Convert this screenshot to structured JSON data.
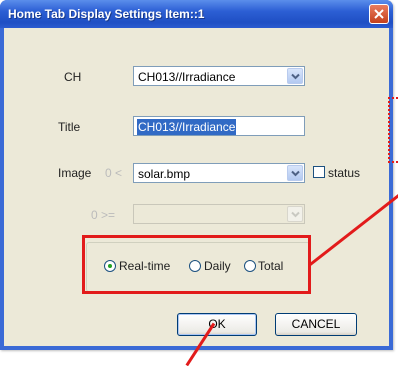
{
  "window": {
    "title": "Home Tab Display Settings Item::1"
  },
  "form": {
    "ch": {
      "label": "CH",
      "value": "CH013//Irradiance"
    },
    "title": {
      "label": "Title",
      "value": "CH013//Irradiance"
    },
    "image": {
      "label": "Image",
      "prefix": "0 <",
      "value": "solar.bmp",
      "checkbox_label": "status"
    },
    "second_image": {
      "prefix": "0 >=",
      "value": ""
    }
  },
  "mode": {
    "options": [
      "Real-time",
      "Daily",
      "Total"
    ],
    "selected": "Real-time"
  },
  "buttons": {
    "ok": "OK",
    "cancel": "CANCEL"
  },
  "colors": {
    "titlebar": "#2c5fd4",
    "dialog_bg": "#ece9d8",
    "highlight": "#e21b1b",
    "selection": "#316ac5"
  }
}
